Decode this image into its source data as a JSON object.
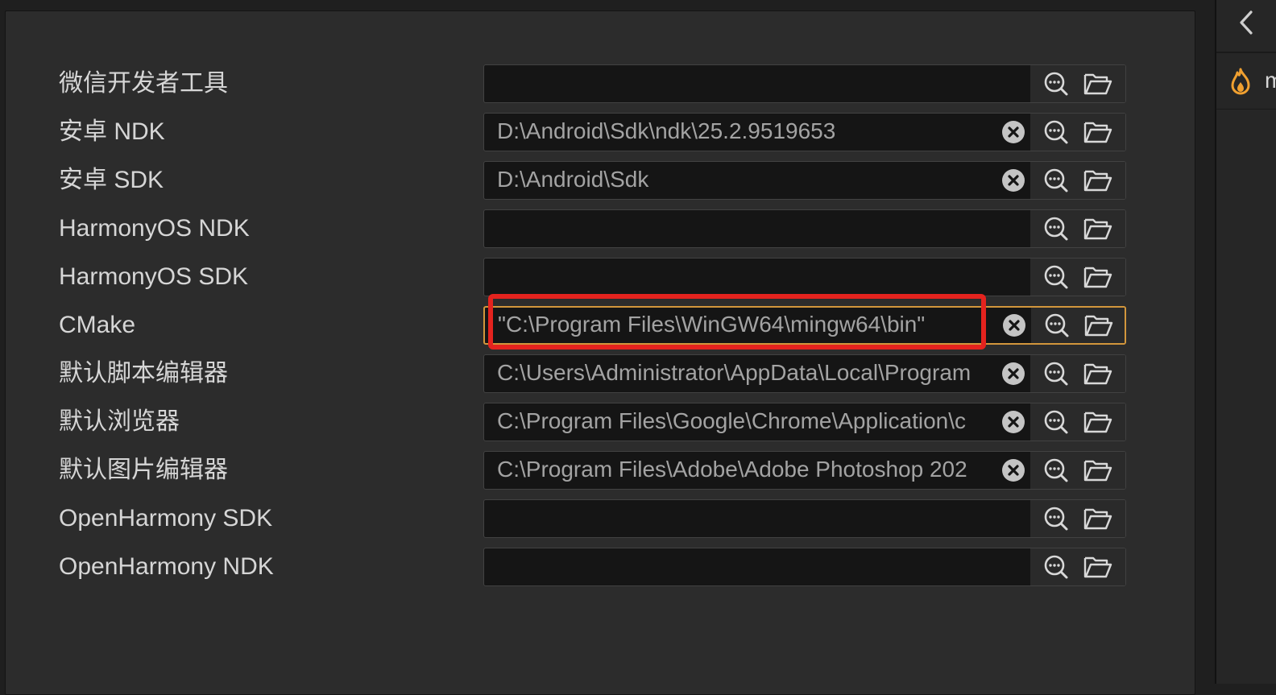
{
  "settings": {
    "rows": [
      {
        "label": "微信开发者工具",
        "value": "",
        "has_clear": false,
        "focused": false
      },
      {
        "label": "安卓 NDK",
        "value": "D:\\Android\\Sdk\\ndk\\25.2.9519653",
        "has_clear": true,
        "focused": false
      },
      {
        "label": "安卓 SDK",
        "value": "D:\\Android\\Sdk",
        "has_clear": true,
        "focused": false
      },
      {
        "label": "HarmonyOS NDK",
        "value": "",
        "has_clear": false,
        "focused": false
      },
      {
        "label": "HarmonyOS SDK",
        "value": "",
        "has_clear": false,
        "focused": false
      },
      {
        "label": "CMake",
        "value": "\"C:\\Program Files\\WinGW64\\mingw64\\bin\"",
        "has_clear": true,
        "focused": true
      },
      {
        "label": "默认脚本编辑器",
        "value": "C:\\Users\\Administrator\\AppData\\Local\\Program",
        "has_clear": true,
        "focused": false
      },
      {
        "label": "默认浏览器",
        "value": "C:\\Program Files\\Google\\Chrome\\Application\\c",
        "has_clear": true,
        "focused": false
      },
      {
        "label": "默认图片编辑器",
        "value": "C:\\Program Files\\Adobe\\Adobe Photoshop 202",
        "has_clear": true,
        "focused": false
      },
      {
        "label": "OpenHarmony SDK",
        "value": "",
        "has_clear": false,
        "focused": false
      },
      {
        "label": "OpenHarmony NDK",
        "value": "",
        "has_clear": false,
        "focused": false
      }
    ]
  },
  "sidebar": {
    "collapse_icon": "chevron-left-icon",
    "item_icon": "flame-icon",
    "item_text": "m"
  },
  "icons": {
    "clear": "close-circle-icon",
    "search": "search-icon",
    "browse": "folder-open-icon"
  },
  "colors": {
    "highlight": "#e4231e",
    "focus_border": "#d2963c",
    "flame": "#f0a030"
  }
}
